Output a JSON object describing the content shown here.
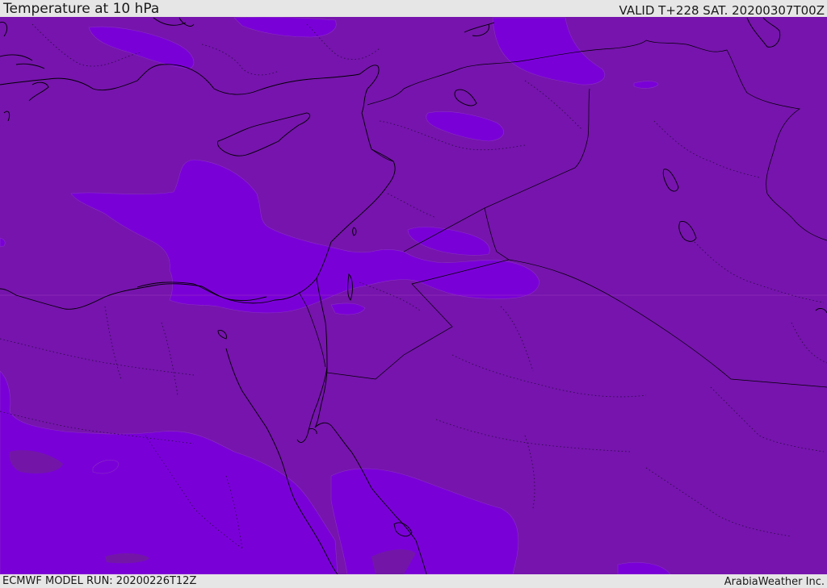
{
  "header": {
    "title": "Temperature at 10 hPa",
    "valid": "VALID T+228 SAT. 20200307T00Z"
  },
  "footer": {
    "model_run": "ECMWF MODEL RUN: 20200226T12Z",
    "credit": "ArabiaWeather Inc."
  },
  "map": {
    "colors": {
      "base_field": "#7614ad",
      "warm_field": "#7a00d8",
      "coastline": "#000000",
      "gridline": "#9a3ab8"
    }
  }
}
